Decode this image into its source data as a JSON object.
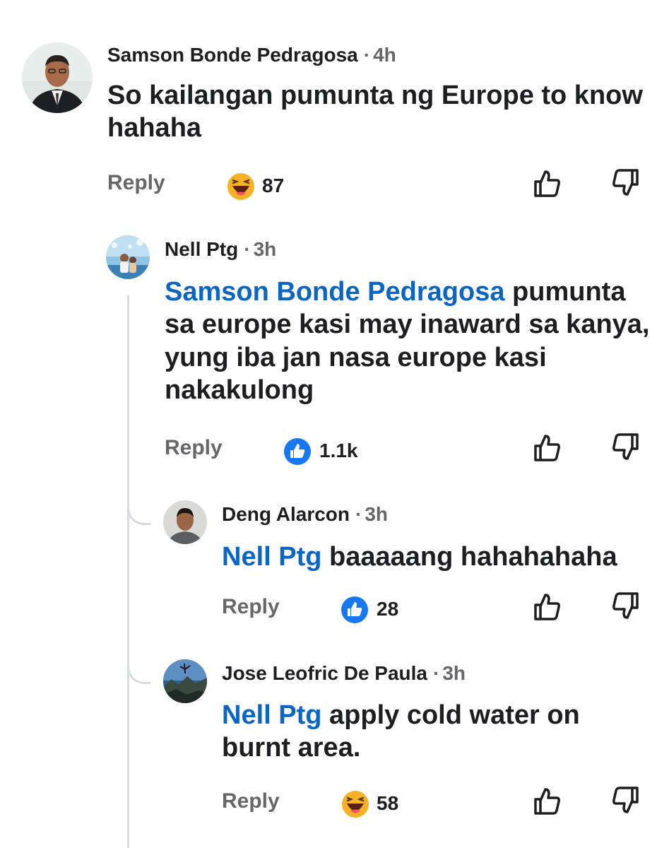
{
  "comments": [
    {
      "author": "Samson Bonde Pedragosa",
      "time": "4h",
      "mention": "",
      "text_lines": [
        "So kailangan pumunta ng Europe to know",
        "hahaha"
      ],
      "reply_label": "Reply",
      "reaction": {
        "icon": "haha-emoji-icon",
        "count": "87"
      }
    },
    {
      "author": "Nell Ptg",
      "time": "3h",
      "mention": "Samson Bonde Pedragosa",
      "text_line1_rest": " pumunta",
      "text_lines": [
        "sa europe kasi may inaward sa kanya,",
        "yung iba jan nasa europe kasi",
        "nakakulong"
      ],
      "reply_label": "Reply",
      "reaction": {
        "icon": "like-icon",
        "count": "1.1k"
      }
    },
    {
      "author": "Deng Alarcon",
      "time": "3h",
      "mention": "Nell Ptg",
      "text_rest": " baaaaang hahahahaha",
      "reply_label": "Reply",
      "reaction": {
        "icon": "like-icon",
        "count": "28"
      }
    },
    {
      "author": "Jose Leofric De Paula",
      "time": "3h",
      "mention": "Nell Ptg",
      "text_rest": " apply cold water on",
      "text_lines": [
        "burnt area."
      ],
      "reply_label": "Reply",
      "reaction": {
        "icon": "haha-emoji-icon",
        "count": "58"
      }
    }
  ],
  "separator": "·",
  "colors": {
    "mention": "#0a66c2",
    "muted": "#65676b",
    "text": "#1c1e21",
    "like_blue": "#1877f2",
    "haha_yellow": "#f7b125"
  }
}
